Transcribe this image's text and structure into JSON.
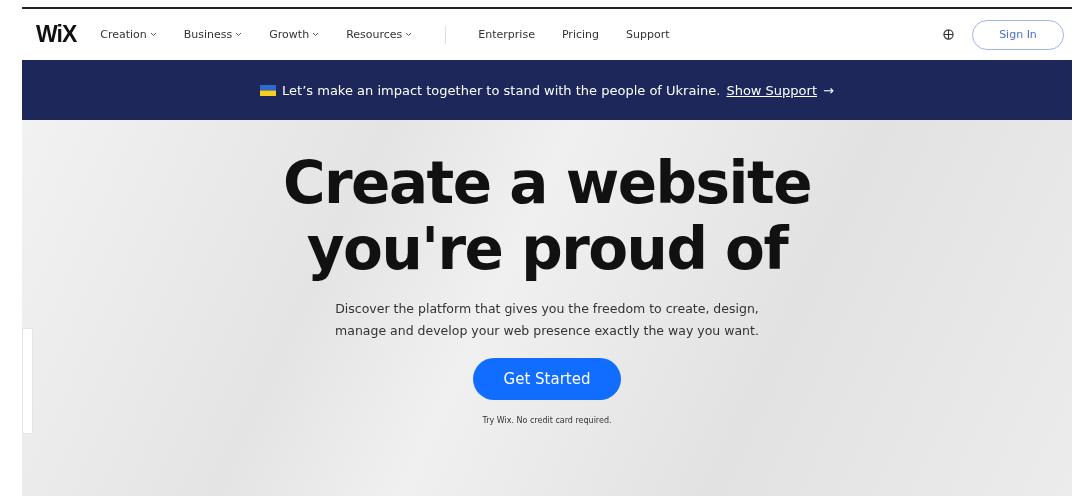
{
  "logo": "WiX",
  "nav": [
    {
      "label": "Creation",
      "kind": "menu"
    },
    {
      "label": "Business",
      "kind": "menu"
    },
    {
      "label": "Growth",
      "kind": "menu"
    },
    {
      "label": "Resources",
      "kind": "menu"
    },
    {
      "label": "Enterprise",
      "kind": "link"
    },
    {
      "label": "Pricing",
      "kind": "link"
    },
    {
      "label": "Support",
      "kind": "link"
    }
  ],
  "sign_in": "Sign In",
  "banner": {
    "text": "Let’s make an impact together to stand with the people of Ukraine.",
    "link": "Show Support",
    "arrow": "→"
  },
  "hero": {
    "title_lines": [
      "Create a website",
      "you're proud of"
    ],
    "subtitle_lines": [
      "Discover the platform that gives you the freedom to create, design,",
      "manage and develop your web presence exactly the way you want."
    ],
    "button": "Get Started",
    "note": "Try Wix. No credit card required."
  }
}
